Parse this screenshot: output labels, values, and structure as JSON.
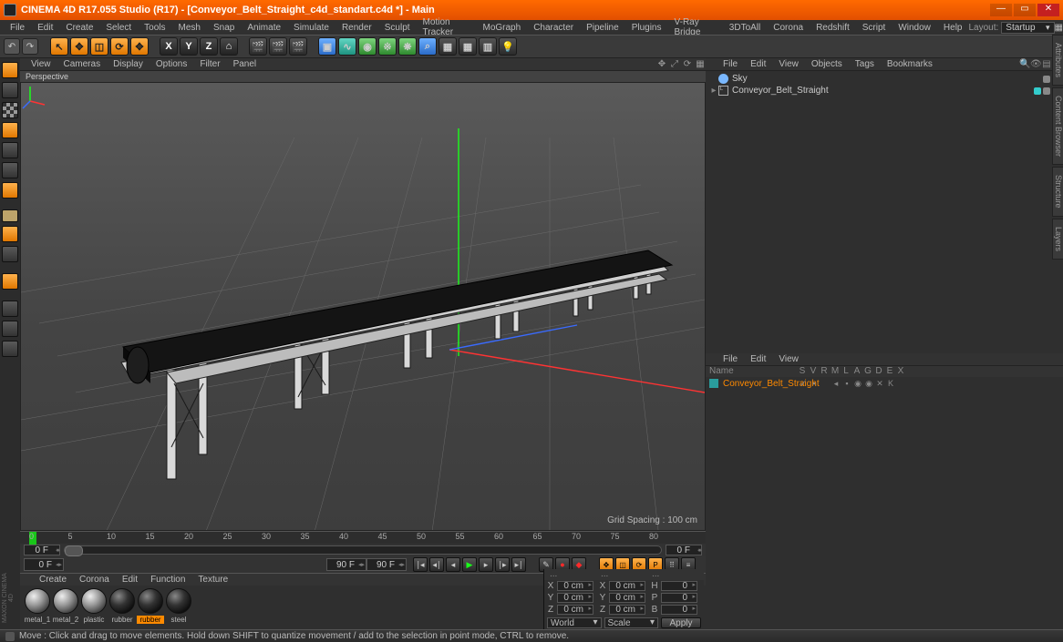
{
  "title": "CINEMA 4D R17.055 Studio (R17) - [Conveyor_Belt_Straight_c4d_standart.c4d *] - Main",
  "menu": [
    "File",
    "Edit",
    "Create",
    "Select",
    "Tools",
    "Mesh",
    "Snap",
    "Animate",
    "Simulate",
    "Render",
    "Sculpt",
    "Motion Tracker",
    "MoGraph",
    "Character",
    "Pipeline",
    "Plugins",
    "V-Ray Bridge",
    "3DToAll",
    "Corona",
    "Redshift",
    "Script",
    "Window",
    "Help"
  ],
  "layout_label": "Layout:",
  "layout_value": "Startup",
  "vpmenu": [
    "View",
    "Cameras",
    "Display",
    "Options",
    "Filter",
    "Panel"
  ],
  "vplabel": "Perspective",
  "grid_spacing": "Grid Spacing : 100 cm",
  "timeline": {
    "start": 0,
    "end": 90,
    "ticks": [
      0,
      5,
      10,
      15,
      20,
      25,
      30,
      35,
      40,
      45,
      50,
      55,
      60,
      65,
      70,
      75,
      80
    ]
  },
  "time_left": "0 F",
  "time_right": "90 F",
  "time_right_end": "90 F",
  "time_zero": "0 F",
  "matmenu": [
    "Create",
    "Corona",
    "Edit",
    "Function",
    "Texture"
  ],
  "materials": [
    {
      "name": "metal_1",
      "dark": false
    },
    {
      "name": "metal_2",
      "dark": false
    },
    {
      "name": "plastic",
      "dark": false
    },
    {
      "name": "rubber",
      "dark": true
    },
    {
      "name": "rubber",
      "dark": true,
      "sel": true
    },
    {
      "name": "steel",
      "dark": true
    }
  ],
  "coords": {
    "cols": [
      "...",
      "...",
      "..."
    ],
    "rows": [
      {
        "l": "X",
        "a": "0 cm",
        "b": "X",
        "c": "0 cm",
        "d": "H",
        "e": "0"
      },
      {
        "l": "Y",
        "a": "0 cm",
        "b": "Y",
        "c": "0 cm",
        "d": "P",
        "e": "0"
      },
      {
        "l": "Z",
        "a": "0 cm",
        "b": "Z",
        "c": "0 cm",
        "d": "B",
        "e": "0"
      }
    ],
    "dd1": "World",
    "dd2": "Scale",
    "apply": "Apply"
  },
  "obj_menu": [
    "File",
    "Edit",
    "View",
    "Objects",
    "Tags",
    "Bookmarks"
  ],
  "objects": [
    {
      "name": "Sky",
      "type": "sky",
      "sel": false
    },
    {
      "name": "Conveyor_Belt_Straight",
      "type": "null",
      "sel": false,
      "exp": true
    }
  ],
  "layer_menu": [
    "File",
    "Edit",
    "View"
  ],
  "layer_cols": [
    "Name",
    "S",
    "V",
    "R",
    "M",
    "L",
    "A",
    "G",
    "D",
    "E",
    "X"
  ],
  "layer": {
    "color": "#2a9d9d",
    "name": "Conveyor_Belt_Straight",
    "flags": [
      "✓",
      "▪",
      "",
      "◂",
      "▪",
      "◉",
      "◉",
      "✕",
      "K"
    ]
  },
  "right_tabs": [
    "Attributes",
    "Content Browser",
    "Structure",
    "Layers"
  ],
  "status": "Move : Click and drag to move elements. Hold down SHIFT to quantize movement / add to the selection in point mode, CTRL to remove.",
  "logo": "MAXON CINEMA 4D"
}
